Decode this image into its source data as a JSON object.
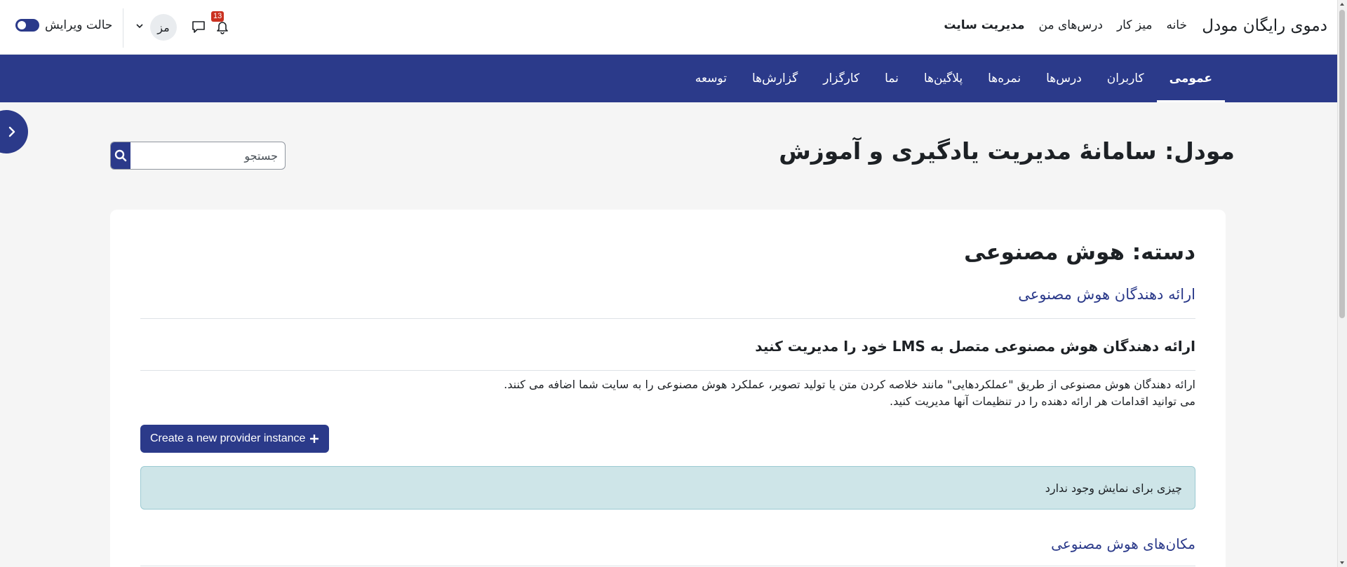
{
  "topnav": {
    "brand": "دموی رایگان مودل",
    "links": [
      "خانه",
      "میز کار",
      "درس‌های من",
      "مدیریت سایت"
    ],
    "notification_count": "13",
    "avatar_initials": "مز",
    "edit_mode_label": "حالت ویرایش"
  },
  "secnav": {
    "items": [
      "عمومی",
      "کاربران",
      "درس‌ها",
      "نمره‌ها",
      "پلاگین‌ها",
      "نما",
      "کارگزار",
      "گزارش‌ها",
      "توسعه"
    ],
    "active": "عمومی"
  },
  "page": {
    "title": "مودل: سامانهٔ مدیریت یادگیری و آموزش",
    "search_placeholder": "جستجو"
  },
  "card": {
    "category_heading": "دسته: هوش مصنوعی",
    "providers_link": "ارائه دهندگان هوش مصنوعی",
    "manage_heading": "ارائه دهندگان هوش مصنوعی متصل به LMS خود را مدیریت کنید",
    "description_line1": "ارائه دهندگان هوش مصنوعی از طریق \"عملکردهایی\" مانند خلاصه کردن متن یا تولید تصویر، عملکرد هوش مصنوعی را به سایت شما اضافه می کنند.",
    "description_line2": "می توانید اقدامات هر ارائه دهنده را در تنظیمات آنها مدیریت کنید.",
    "create_button": "Create a new provider instance",
    "alert_text": "چیزی برای نمایش وجود ندارد",
    "placements_link": "مکان‌های هوش مصنوعی"
  },
  "colors": {
    "primary": "#2b3a8a",
    "alert_bg": "#cee5e8",
    "badge": "#ca3120"
  }
}
